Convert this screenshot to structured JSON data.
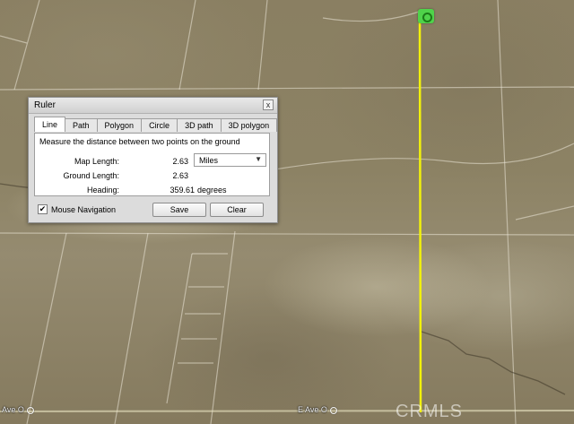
{
  "ruler": {
    "title": "Ruler",
    "close_glyph": "x",
    "tabs": [
      "Line",
      "Path",
      "Polygon",
      "Circle",
      "3D path",
      "3D polygon"
    ],
    "active_tab": "Line",
    "description": "Measure the distance between two points on the ground",
    "map_length_label": "Map Length:",
    "map_length_value": "2.63",
    "unit": "Miles",
    "ground_length_label": "Ground Length:",
    "ground_length_value": "2.63",
    "heading_label": "Heading:",
    "heading_value": "359.61",
    "heading_unit": "degrees",
    "mouse_navigation_label": "Mouse Navigation",
    "mouse_navigation_checked": true,
    "save_label": "Save",
    "clear_label": "Clear"
  },
  "map": {
    "road_label_left": "Ave O",
    "road_label_center": "E Ave O",
    "watermark": "CRMLS",
    "measure_line_color": "#f2f20a"
  }
}
